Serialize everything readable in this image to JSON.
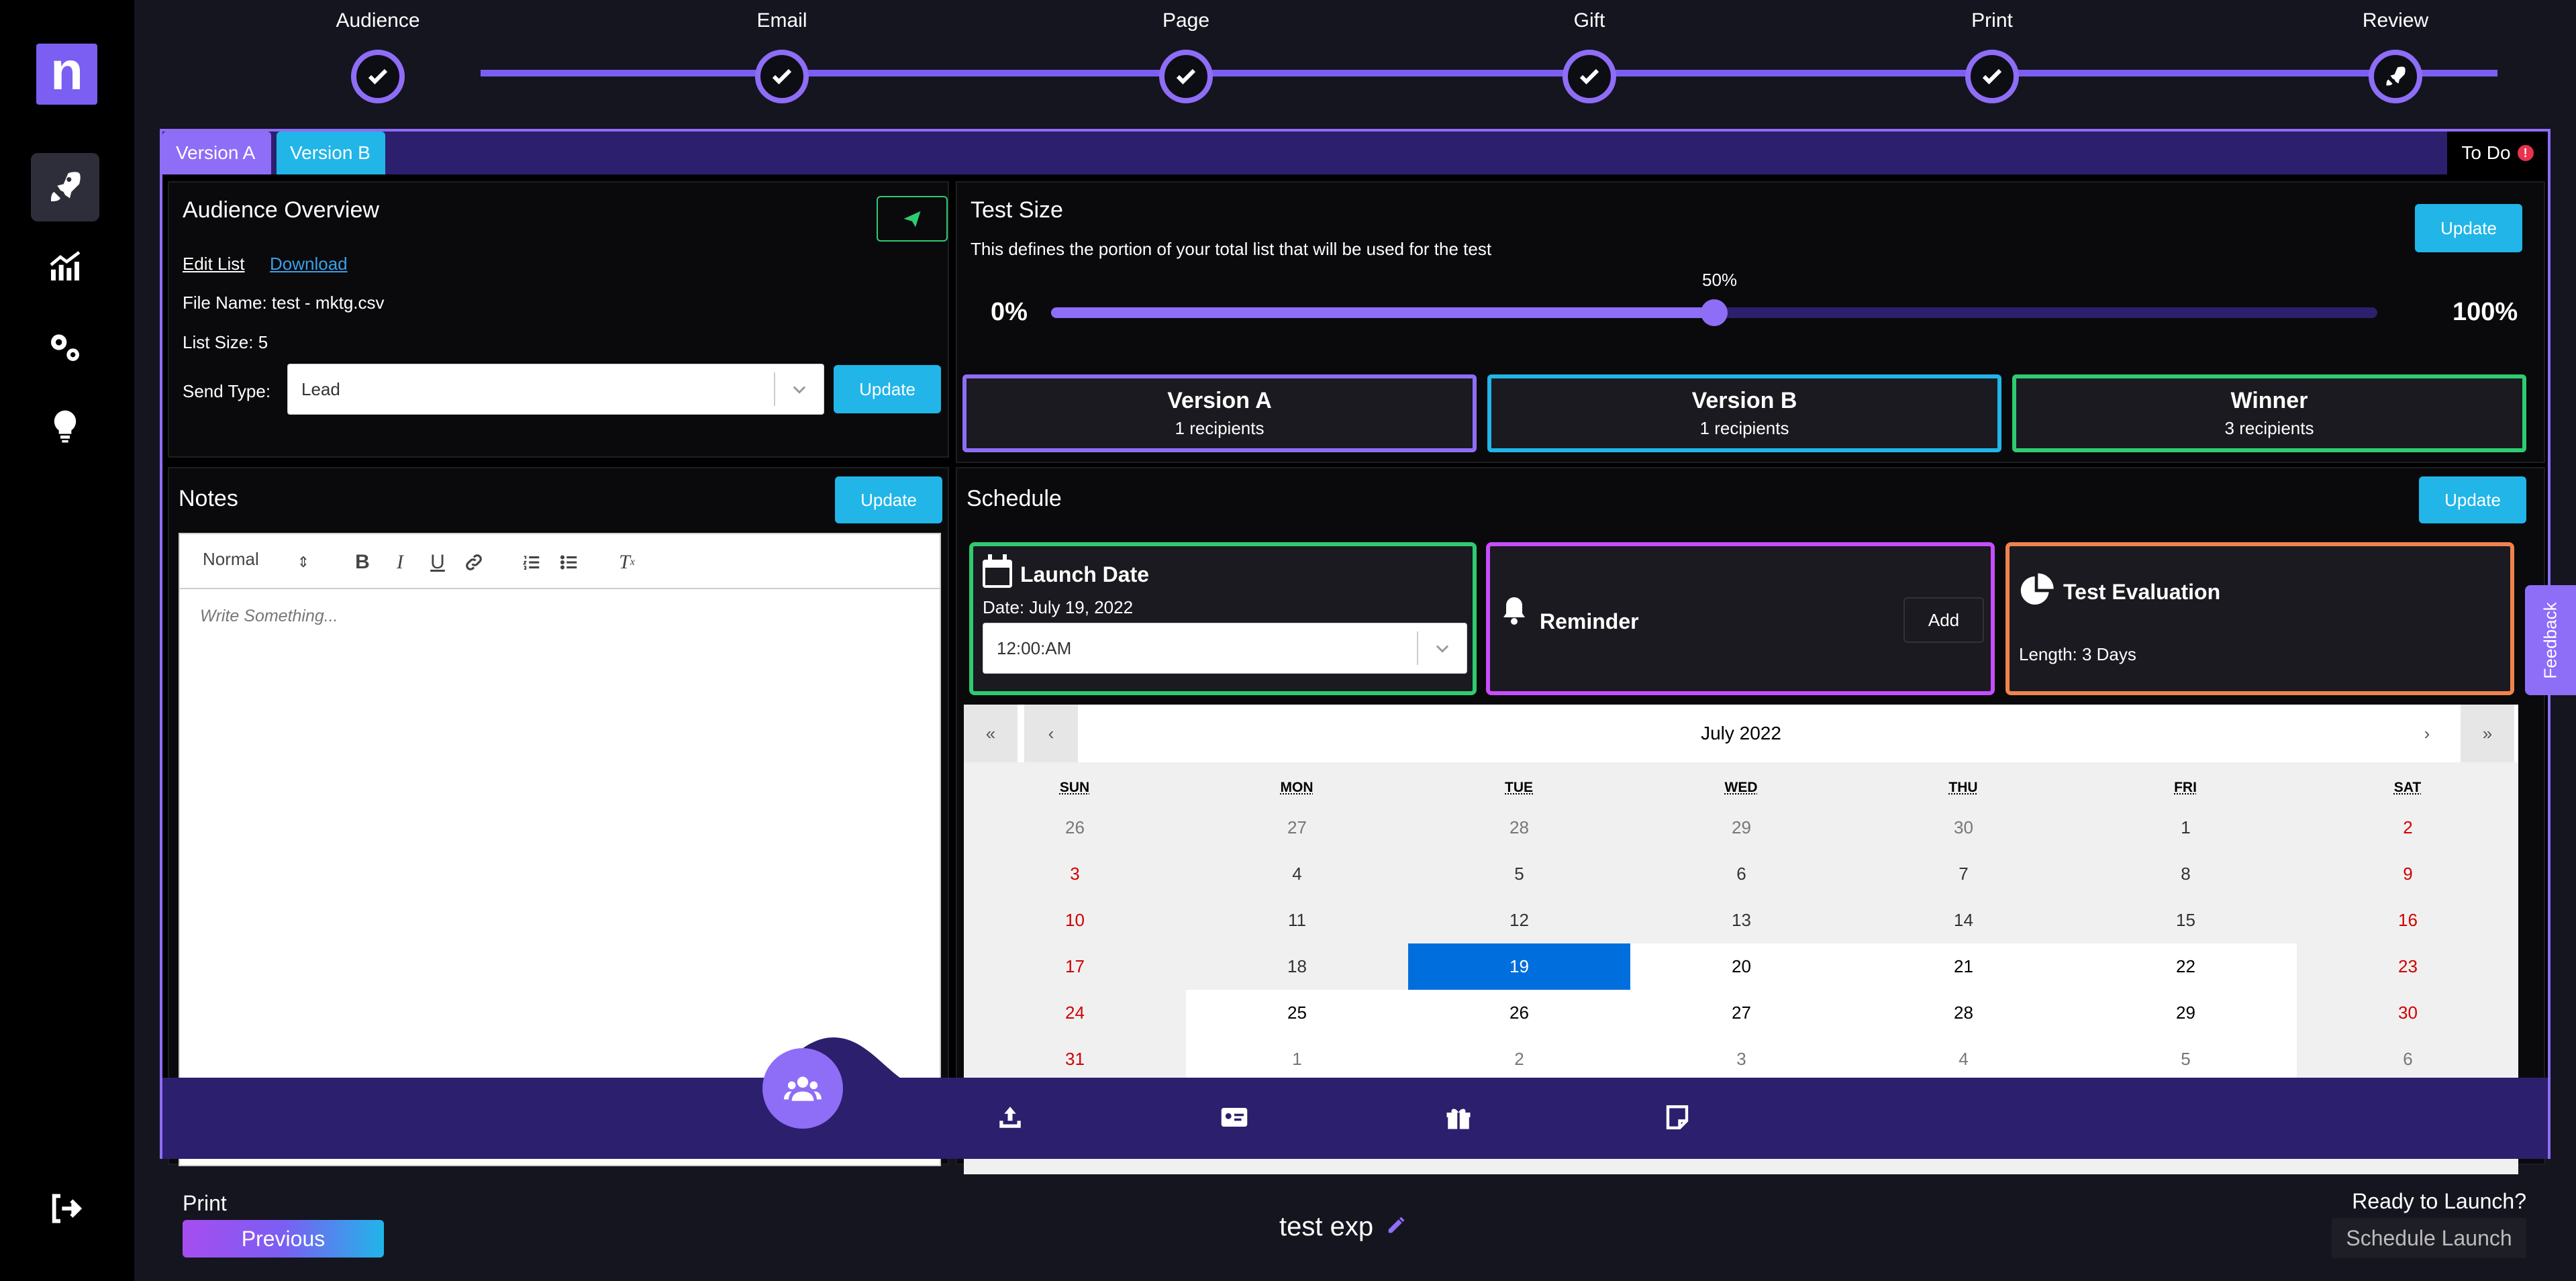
{
  "app": {
    "logo_letter": "n",
    "accent": "#7b5ef2",
    "cyan": "#21b5e8",
    "green": "#2ecc71",
    "orange": "#f0834d",
    "magenta": "#c74dff"
  },
  "sidebar": {
    "items": [
      {
        "name": "rocket-icon",
        "active": true
      },
      {
        "name": "analytics-icon",
        "active": false
      },
      {
        "name": "settings-gears-icon",
        "active": false
      },
      {
        "name": "lightbulb-icon",
        "active": false
      }
    ],
    "logout": "logout-icon"
  },
  "stepper": {
    "steps": [
      {
        "label": "Audience",
        "done": true
      },
      {
        "label": "Email",
        "done": true
      },
      {
        "label": "Page",
        "done": true
      },
      {
        "label": "Gift",
        "done": true
      },
      {
        "label": "Print",
        "done": true
      },
      {
        "label": "Review",
        "done": false
      }
    ]
  },
  "tabs": {
    "version_a": "Version A",
    "version_b": "Version B",
    "todo": "To Do",
    "todo_badge": "!"
  },
  "audience": {
    "title": "Audience Overview",
    "edit_list": "Edit List",
    "download": "Download",
    "file_name": "File Name: test - mktg.csv",
    "list_size": "List Size: 5",
    "send_type_label": "Send Type:",
    "send_type_value": "Lead",
    "update": "Update"
  },
  "test_size": {
    "title": "Test Size",
    "description": "This defines the portion of your total list that will be used for the test",
    "min_label": "0%",
    "max_label": "100%",
    "value_label": "50%",
    "value": 0.5,
    "update": "Update",
    "versions": [
      {
        "title": "Version A",
        "sub": "1 recipients",
        "color": "#8e6df7"
      },
      {
        "title": "Version B",
        "sub": "1 recipients",
        "color": "#21b5e8"
      },
      {
        "title": "Winner",
        "sub": "3 recipients",
        "color": "#2ecc71"
      }
    ]
  },
  "notes": {
    "title": "Notes",
    "update": "Update",
    "format_select": "Normal",
    "placeholder": "Write Something..."
  },
  "schedule": {
    "title": "Schedule",
    "update": "Update",
    "launch_title": "Launch Date",
    "launch_date": "Date: July 19, 2022",
    "launch_time": "12:00:AM",
    "reminder_title": "Reminder",
    "reminder_add": "Add",
    "eval_title": "Test Evaluation",
    "eval_length": "Length: 3 Days"
  },
  "calendar": {
    "month": "July 2022",
    "nav": {
      "prev2": "«",
      "prev": "‹",
      "next": "›",
      "next2": "»"
    },
    "weekdays": [
      "SUN",
      "MON",
      "TUE",
      "WED",
      "THU",
      "FRI",
      "SAT"
    ],
    "weeks": [
      [
        "26",
        "27",
        "28",
        "29",
        "30",
        "1",
        "2"
      ],
      [
        "3",
        "4",
        "5",
        "6",
        "7",
        "8",
        "9"
      ],
      [
        "10",
        "11",
        "12",
        "13",
        "14",
        "15",
        "16"
      ],
      [
        "17",
        "18",
        "19",
        "20",
        "21",
        "22",
        "23"
      ],
      [
        "24",
        "25",
        "26",
        "27",
        "28",
        "29",
        "30"
      ],
      [
        "31",
        "1",
        "2",
        "3",
        "4",
        "5",
        "6"
      ]
    ],
    "selected": "19"
  },
  "footer": {
    "print_label": "Print",
    "previous": "Previous",
    "project_name": "test exp",
    "ready": "Ready to Launch?",
    "schedule_launch": "Schedule Launch",
    "feedback": "Feedback"
  }
}
